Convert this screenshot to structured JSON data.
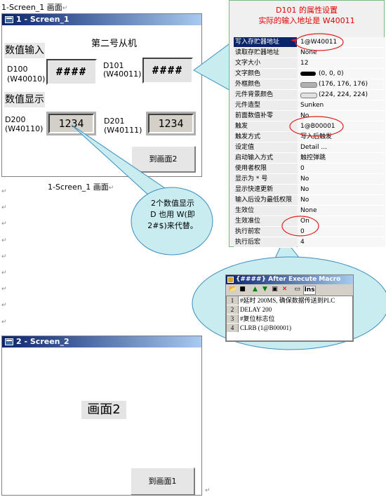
{
  "doc": {
    "caption_top": "1-Screen_1 画面",
    "caption_mid": "1-Screen_1 画面",
    "return_mark": "↵"
  },
  "screen1": {
    "title": "1 - Screen_1",
    "heading": "第二号从机",
    "input_section_label": "数值输入",
    "display_section_label": "数值显示",
    "d100_label": "D100",
    "d100_addr": "(W40010)",
    "d100_value": "####",
    "d101_label": "D101",
    "d101_addr": "(W40011)",
    "d101_value": "####",
    "d200_label": "D200",
    "d200_addr": "(W40110)",
    "d200_value": "1234",
    "d201_label": "D201",
    "d201_addr": "(W40111)",
    "d201_value": "1234",
    "goto_button": "到画面2"
  },
  "callout_bubble": {
    "line1": "2个数值显示",
    "line2": "D 也用 W(即",
    "line3": "2#$)来代替。"
  },
  "properties": {
    "heading_line1": "D101 的属性设置",
    "heading_line2": "实际的输入地址是 W40011",
    "rows": [
      {
        "name": "写入存贮器地址",
        "value": "1@W40011",
        "selected": true
      },
      {
        "name": "读取存贮器地址",
        "value": "None"
      },
      {
        "name": "文字大小",
        "value": "12"
      },
      {
        "name": "文字颜色",
        "value": "(0, 0, 0)",
        "swatch": "#000000"
      },
      {
        "name": "外框颜色",
        "value": "(176, 176, 176)",
        "swatch": "#b0b0b0"
      },
      {
        "name": "元件背景颜色",
        "value": "(224, 224, 224)",
        "swatch": "#e0e0e0"
      },
      {
        "name": "元件造型",
        "value": "Sunken"
      },
      {
        "name": "前面数值补零",
        "value": "No"
      },
      {
        "name": "触发",
        "value": "1@B00001"
      },
      {
        "name": "触发方式",
        "value": "写入后触发"
      },
      {
        "name": "设定值",
        "value": "Detail ..."
      },
      {
        "name": "启动输入方式",
        "value": "触控弹跳"
      },
      {
        "name": "使用者权限",
        "value": "0"
      },
      {
        "name": "显示为 * 号",
        "value": "No"
      },
      {
        "name": "显示快速更新",
        "value": "No"
      },
      {
        "name": "输入后设为最低权限",
        "value": "No"
      },
      {
        "name": "生效位",
        "value": "None"
      },
      {
        "name": "生效准位",
        "value": "On"
      },
      {
        "name": "执行前宏",
        "value": "0"
      },
      {
        "name": "执行后宏",
        "value": "4"
      }
    ]
  },
  "macro": {
    "title": "{####} After Execute Macro",
    "toolbar_ins": "Ins",
    "lines": [
      {
        "num": "1",
        "text": "#延时 200MS, 确保数据传送到PLC"
      },
      {
        "num": "2",
        "text": "DELAY 200"
      },
      {
        "num": "3",
        "text": "#复位标志位"
      },
      {
        "num": "4",
        "text": "CLRB (1@B00001)"
      }
    ]
  },
  "screen2": {
    "title": "2 - Screen_2",
    "center_label": "画面2",
    "goto_button": "到画面1"
  },
  "colors": {
    "titlebar": "#0a246a",
    "highlight_ellipse": "#e02020",
    "bubble_fill": "#c8ecf0",
    "bubble_stroke": "#3a8ec0",
    "heading_red": "#e00000"
  }
}
